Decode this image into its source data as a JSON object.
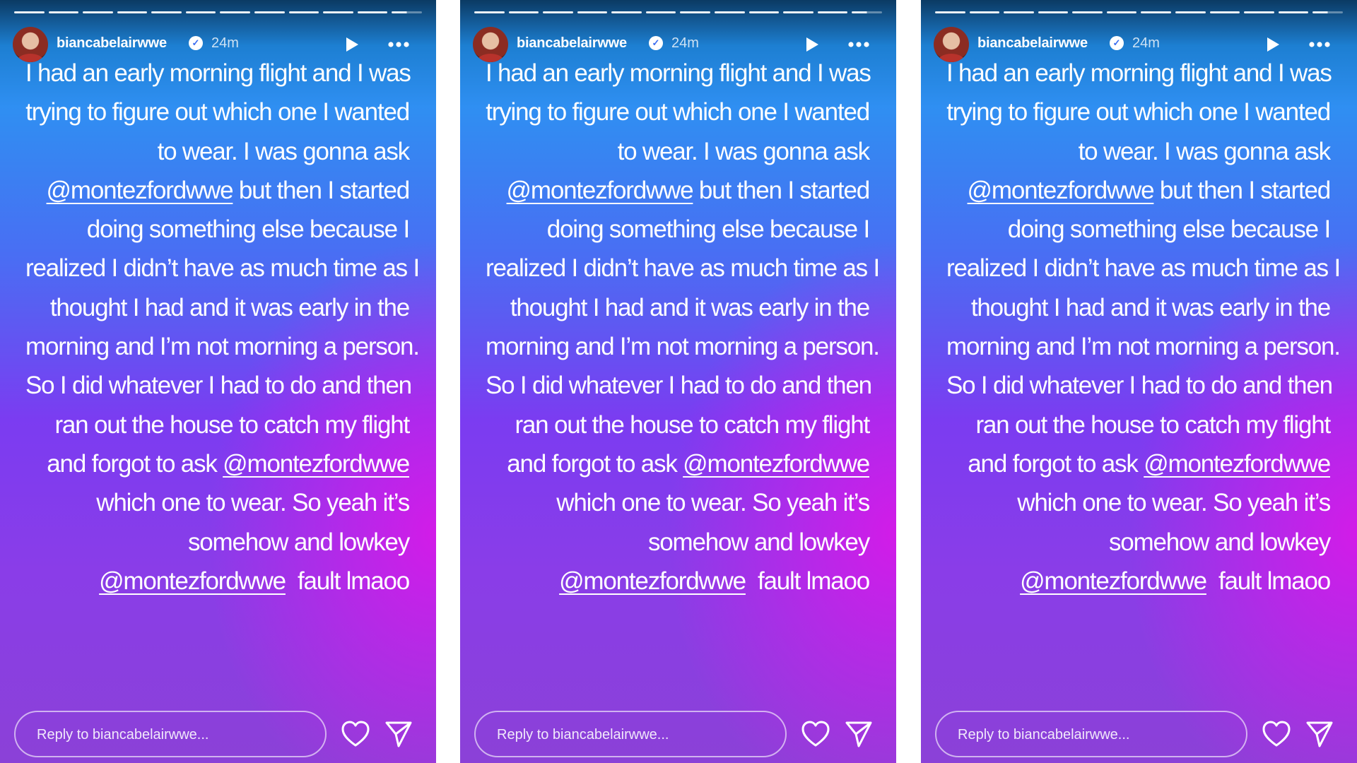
{
  "stories": [
    {
      "username": "biancabelairwwe",
      "timestamp": "24m",
      "reply_placeholder": "Reply to biancabelairwwe...",
      "lines": [
        [
          "I had an early morning flight and I was"
        ],
        [
          "trying to figure out which one I wanted"
        ],
        [
          "to wear. I was gonna ask"
        ],
        [
          "@montezfordwwe",
          " but then I started"
        ],
        [
          "doing something else because I"
        ],
        [
          "realized I didn’t have as much time as I"
        ],
        [
          "thought I had and it was early in the"
        ],
        [
          "morning and I’m not morning a person."
        ],
        [
          "So I did whatever I had to do and then"
        ],
        [
          "ran out the house to catch my flight"
        ],
        [
          "and forgot to ask ",
          "@montezfordwwe"
        ],
        [
          "which one to wear. So yeah it’s"
        ],
        [
          "somehow and lowkey"
        ],
        [
          "@montezfordwwe",
          "  fault lmaoo"
        ]
      ]
    },
    {
      "username": "biancabelairwwe",
      "timestamp": "24m",
      "reply_placeholder": "Reply to biancabelairwwe...",
      "lines": [
        [
          "I had an early morning flight and I was"
        ],
        [
          "trying to figure out which one I wanted"
        ],
        [
          "to wear. I was gonna ask"
        ],
        [
          "@montezfordwwe",
          " but then I started"
        ],
        [
          "doing something else because I"
        ],
        [
          "realized I didn’t have as much time as I"
        ],
        [
          "thought I had and it was early in the"
        ],
        [
          "morning and I’m not morning a person."
        ],
        [
          "So I did whatever I had to do and then"
        ],
        [
          "ran out the house to catch my flight"
        ],
        [
          "and forgot to ask ",
          "@montezfordwwe"
        ],
        [
          "which one to wear. So yeah it’s"
        ],
        [
          "somehow and lowkey"
        ],
        [
          "@montezfordwwe",
          "  fault lmaoo"
        ]
      ]
    },
    {
      "username": "biancabelairwwe",
      "timestamp": "24m",
      "reply_placeholder": "Reply to biancabelairwwe...",
      "lines": [
        [
          "I had an early morning flight and I was"
        ],
        [
          "trying to figure out which one I wanted"
        ],
        [
          "to wear. I was gonna ask"
        ],
        [
          "@montezfordwwe",
          " but then I started"
        ],
        [
          "doing something else because I"
        ],
        [
          "realized I didn’t have as much time as I"
        ],
        [
          "thought I had and it was early in the"
        ],
        [
          "morning and I’m not morning a person."
        ],
        [
          "So I did whatever I had to do and then"
        ],
        [
          "ran out the house to catch my flight"
        ],
        [
          "and forgot to ask ",
          "@montezfordwwe"
        ],
        [
          "which one to wear. So yeah it’s"
        ],
        [
          "somehow and lowkey"
        ],
        [
          "@montezfordwwe",
          "  fault lmaoo"
        ]
      ]
    }
  ],
  "icons": {
    "verified": "verified-badge-icon",
    "play": "play-icon",
    "more": "more-icon",
    "like": "heart-icon",
    "share": "send-icon"
  },
  "colors": {
    "gradient_top": "#2f8ff2",
    "gradient_mid": "#7b3cf1",
    "gradient_accent": "#d61ae8",
    "text": "#ffffff"
  }
}
